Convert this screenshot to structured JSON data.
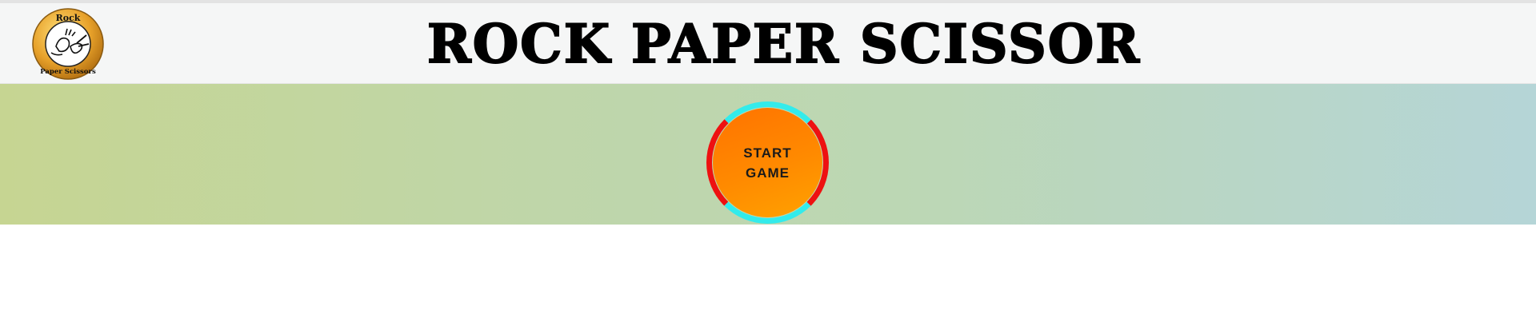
{
  "header": {
    "title": "ROCK PAPER SCISSOR",
    "logo": {
      "icon": "rock-paper-scissors-badge-icon",
      "text_top": "Rock",
      "text_bottom": "Paper Scissors"
    }
  },
  "start_button": {
    "line1": "START",
    "line2": "GAME"
  },
  "colors": {
    "ring_cyan": "#33ebeb",
    "ring_red": "#ee1111",
    "button_orange": "#ff8a00"
  }
}
